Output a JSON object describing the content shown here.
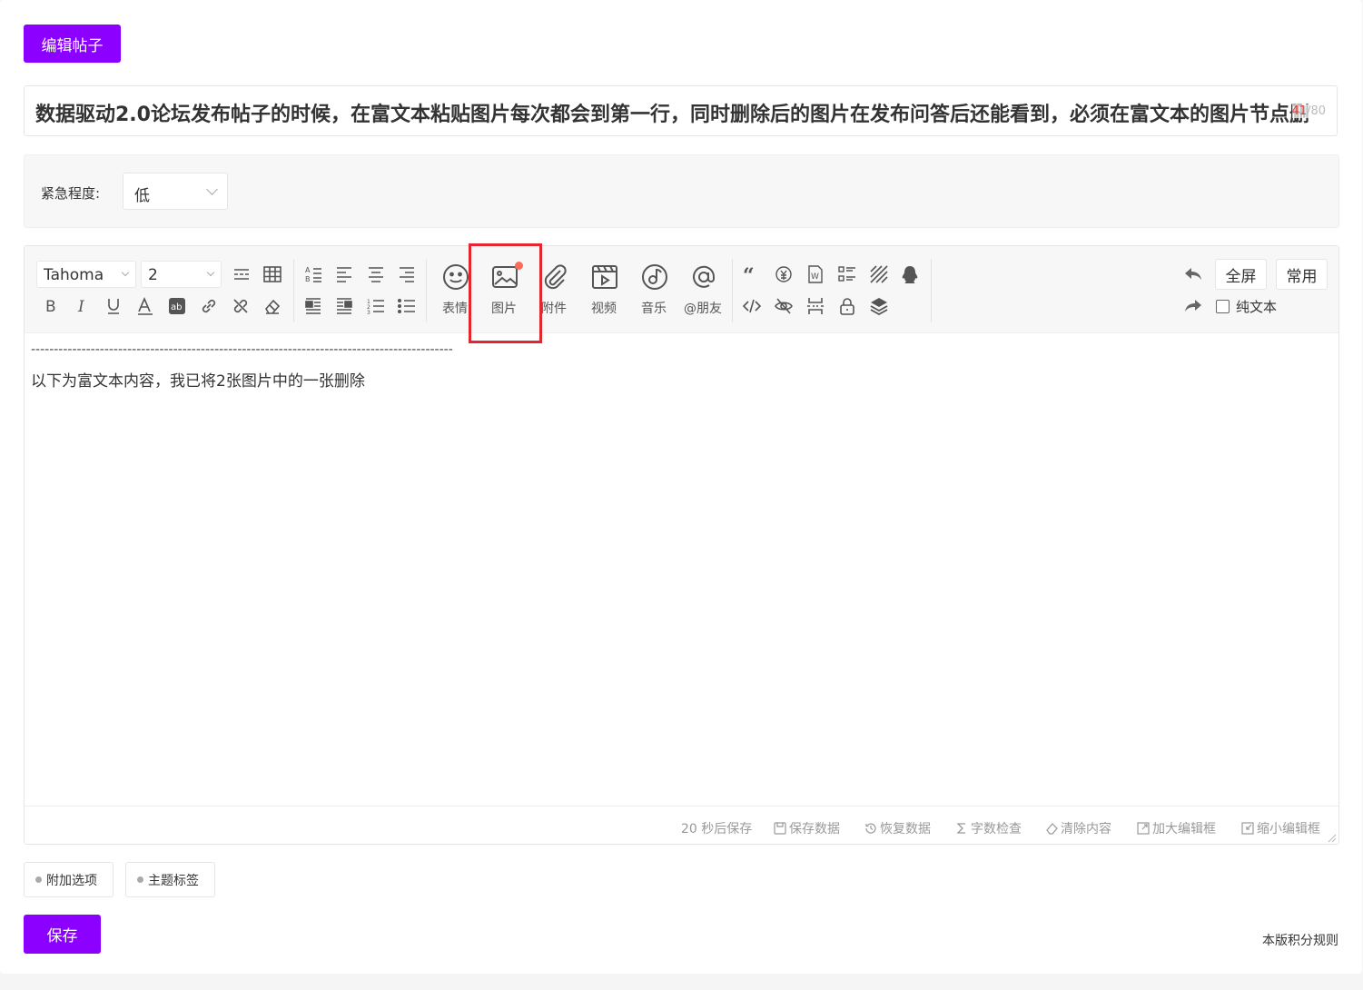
{
  "header": {
    "edit_label": "编辑帖子"
  },
  "title": {
    "value": "数据驱动2.0论坛发布帖子的时候，在富文本粘贴图片每次都会到第一行，同时删除后的图片在发布问答后还能看到，必须在富文本的图片节点删",
    "count": "41",
    "count_max": "80"
  },
  "urgency": {
    "label": "紧急程度:",
    "value": "低"
  },
  "toolbar": {
    "font_family": "Tahoma",
    "font_size": "2",
    "emoji_label": "表情",
    "image_label": "图片",
    "attach_label": "附件",
    "video_label": "视频",
    "music_label": "音乐",
    "mention_label": "@朋友",
    "fullscreen_label": "全屏",
    "common_label": "常用",
    "plaintext_label": "纯文本"
  },
  "content": {
    "dashes": "--------------------------------------------------------------------------------------------",
    "line1": "以下为富文本内容，我已将2张图片中的一张删除"
  },
  "statusbar": {
    "autosave": "20 秒后保存",
    "save_data": "保存数据",
    "restore_data": "恢复数据",
    "word_check": "字数检查",
    "clear_content": "清除内容",
    "enlarge": "加大编辑框",
    "shrink": "缩小编辑框"
  },
  "options": {
    "extra": "附加选项",
    "tags": "主题标签"
  },
  "footer": {
    "save_label": "保存",
    "rules_link": "本版积分规则"
  },
  "colors": {
    "accent": "#8b00ff",
    "highlight": "#e3262f",
    "badge": "#ff6b5a"
  }
}
